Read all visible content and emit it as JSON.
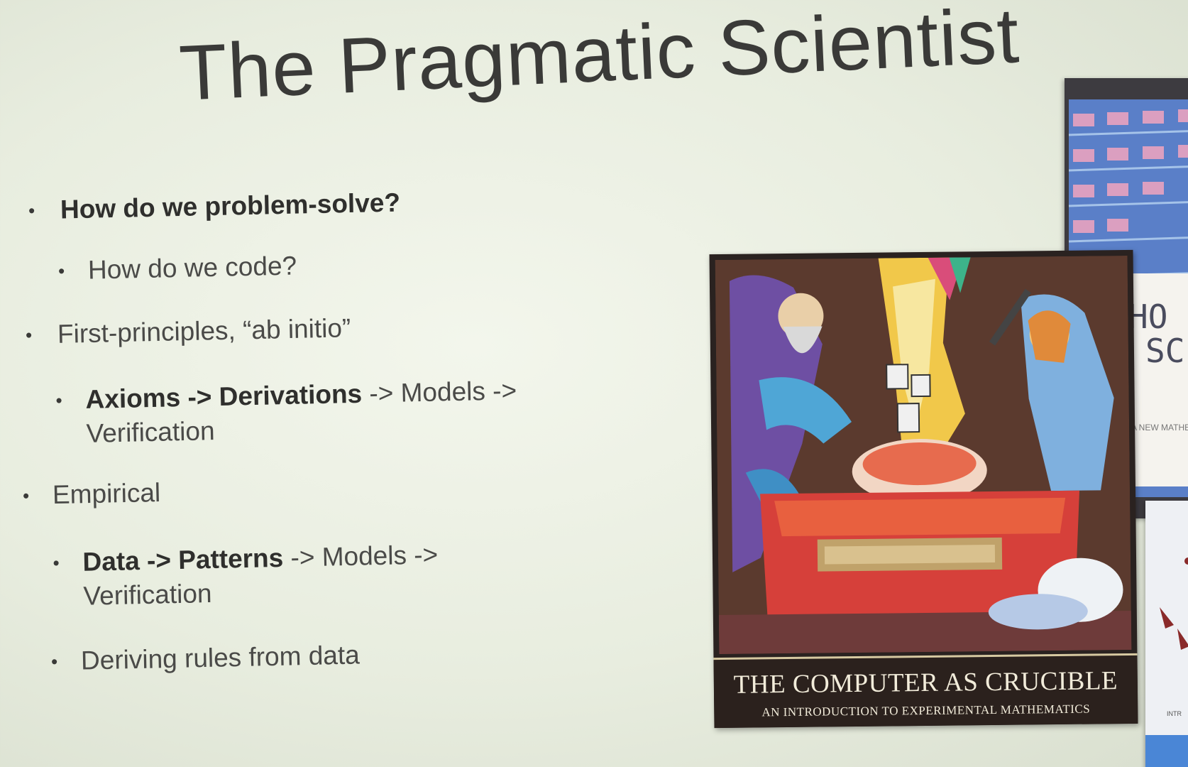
{
  "slide": {
    "title": "The Pragmatic Scientist",
    "bullets": [
      {
        "level": 1,
        "strong": "How do we problem-solve?",
        "rest": ""
      },
      {
        "level": 2,
        "strong": "",
        "rest": "How do we code?"
      },
      {
        "level": 1,
        "strong": "",
        "rest": "First-principles, “ab initio”"
      },
      {
        "level": 2,
        "strong": "Axioms -> Derivations",
        "rest": " -> Models ->",
        "line2": "Verification"
      },
      {
        "level": 1,
        "strong": "",
        "rest": "Empirical"
      },
      {
        "level": 2,
        "strong": "Data -> Patterns",
        "rest": " -> Models ->",
        "line2": "Verification"
      },
      {
        "level": 2,
        "strong": "",
        "rest": "Deriving rules from data"
      }
    ]
  },
  "book_main": {
    "title": "THE COMPUTER AS CRUCIBLE",
    "subtitle": "AN INTRODUCTION TO EXPERIMENTAL MATHEMATICS"
  },
  "book_back": {
    "title_fragment_1": "HO",
    "title_fragment_2": "SC",
    "small_text": "A NEW MATHEM"
  },
  "book_right": {
    "small_text": "INTR"
  },
  "colors": {
    "background": "#eef2e6",
    "title": "#3a3a38",
    "text": "#4a4a48",
    "cover_band": "#2b211d"
  }
}
